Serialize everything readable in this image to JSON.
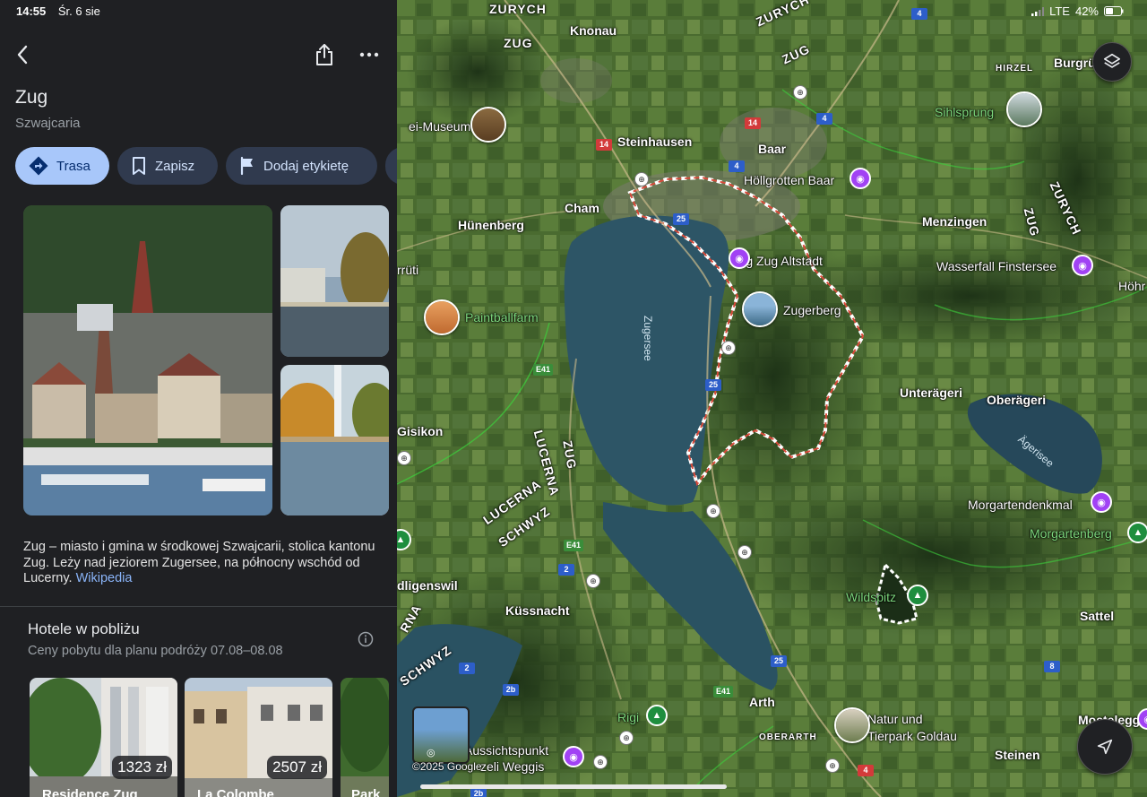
{
  "status": {
    "time": "14:55",
    "date": "Śr. 6 sie",
    "network": "LTE",
    "battery": "42%"
  },
  "place": {
    "title": "Zug",
    "subtitle": "Szwajcaria"
  },
  "actions": [
    {
      "label": "Trasa"
    },
    {
      "label": "Zapisz"
    },
    {
      "label": "Dodaj etykietę"
    }
  ],
  "description": {
    "text": "Zug – miasto i gmina w środkowej Szwajcarii, stolica kantonu Zug. Leży nad jeziorem Zugersee, na północny wschód od Lucerny.",
    "link": "Wikipedia"
  },
  "hotels": {
    "title": "Hotele w pobliżu",
    "subtitle": "Ceny pobytu dla planu podróży 07.08–08.08",
    "items": [
      {
        "price": "1323 zł",
        "name": "Residence Zug"
      },
      {
        "price": "2507 zł",
        "name": "La Colombe"
      },
      {
        "price": "",
        "name": "Park"
      }
    ]
  },
  "map": {
    "copyright": "©2025 Google",
    "labels": {
      "zurych_top": "ZURYCH",
      "knonau": "Knonau",
      "zurych_mid": "ZURYCH",
      "zug_top": "ZUG",
      "zug_tl": "ZUG",
      "hirzel": "HIRZEL",
      "burgrueti": "Burgrüti",
      "museum": "ei-Museum",
      "steinhausen": "Steinhausen",
      "baar": "Baar",
      "sihlsprung": "Sihlsprung",
      "hoellgrotten": "Höllgrotten Baar",
      "zurych_right": "ZURYCH",
      "zug_right": "ZUG",
      "huenenberg": "Hünenberg",
      "cham": "Cham",
      "menzingen": "Menzingen",
      "zug_altstadt": "Zug Zug Altstadt",
      "wasserfall": "Wasserfall Finstersee",
      "hoehr": "Höhr",
      "rruti": "rrüti",
      "paintball": "Paintballfarm",
      "zugerberg": "Zugerberg",
      "zugersee": "Zugersee",
      "unteraegeri": "Unterägeri",
      "oberaegeri": "Oberägeri",
      "aegerisee": "Ägerisee",
      "gisikon": "Gisikon",
      "lucerna1": "LUCERNA",
      "zug_low": "ZUG",
      "lucerna2": "LUCERNA",
      "schwyz1": "SCHWYZ",
      "morgartendenkmal": "Morgartendenkmal",
      "morgartenberg": "Morgartenberg",
      "adligenswil": "dligenswil",
      "wildspitz": "Wildspitz",
      "kuessnacht": "Küssnacht",
      "sattel": "Sattel",
      "lucerna3": "RNA",
      "schwyz2": "SCHWYZ",
      "arth": "Arth",
      "rigi": "Rigi",
      "natur": "Natur und",
      "tierpark": "Tierpark Goldau",
      "mostelegg": "Mostelegg",
      "oberarth": "OBERARTH",
      "aussicht": "Aussichtspunkt",
      "weggis": "zeli Weggis",
      "steinen": "Steinen"
    },
    "roads": [
      "4",
      "14",
      "14",
      "4",
      "4",
      "25",
      "25",
      "E41",
      "E41",
      "2",
      "2",
      "2b",
      "25",
      "E41",
      "8",
      "8",
      "4",
      "4",
      "2b",
      "8"
    ]
  }
}
